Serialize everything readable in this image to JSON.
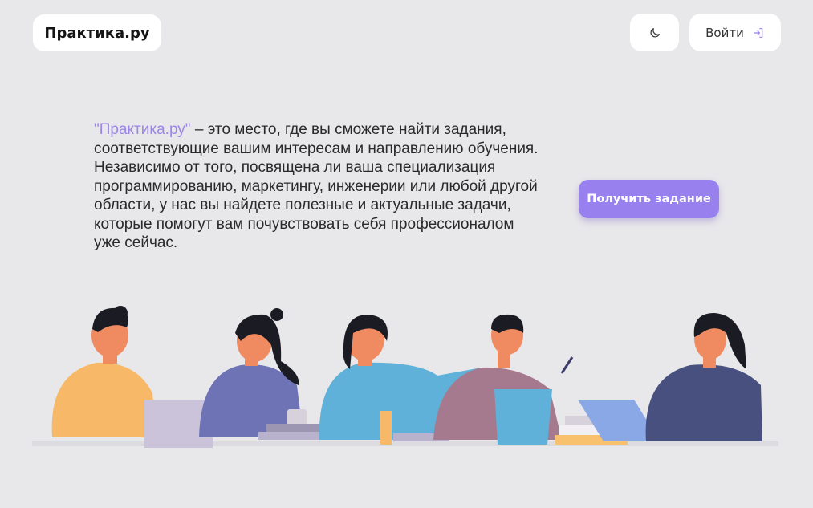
{
  "header": {
    "logo_text": "Практика.ру",
    "theme_toggle_icon": "moon-icon",
    "login_label": "Войти",
    "login_icon": "sign-in-icon"
  },
  "intro": {
    "brand_quote": "\"Практика.ру\"",
    "text": " – это место, где вы сможете найти задания, соответствующие вашим интересам и направлению обучения. Независимо от того, посвящена ли ваша специализация программированию, маркетингу, инженерии или любой другой области, у нас вы найдете полезные и актуальные задачи, которые помогут вам почувствовать себя профессионалом уже сейчас."
  },
  "cta": {
    "label": "Получить задание"
  },
  "colors": {
    "accent": "#9880ee",
    "background": "#e8e7e9",
    "card": "#ffffff"
  }
}
